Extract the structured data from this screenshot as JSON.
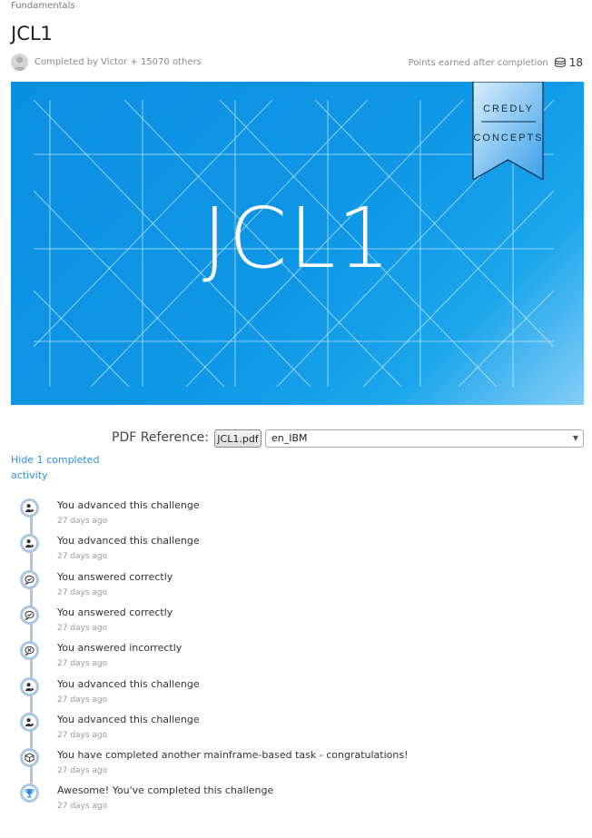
{
  "breadcrumb": "Fundamentals",
  "title": "JCL1",
  "completed_by": "Completed by Victor + 15070 others",
  "points": {
    "label": "Points earned after completion",
    "value": "18",
    "icon": "coins-icon"
  },
  "banner": {
    "title": "JCL1",
    "ribbon_top": "CREDLY",
    "ribbon_bottom": "CONCEPTS"
  },
  "pdf": {
    "label": "PDF Reference:",
    "button": "JCL1.pdf",
    "selected": "en_IBM"
  },
  "hide_link": "Hide 1 completed activity",
  "activities": [
    {
      "text": "You advanced this challenge",
      "time": "27 days ago",
      "icon": "advance-icon"
    },
    {
      "text": "You advanced this challenge",
      "time": "27 days ago",
      "icon": "advance-icon"
    },
    {
      "text": "You answered correctly",
      "time": "27 days ago",
      "icon": "check-icon"
    },
    {
      "text": "You answered correctly",
      "time": "27 days ago",
      "icon": "check-icon"
    },
    {
      "text": "You answered incorrectly",
      "time": "27 days ago",
      "icon": "x-icon"
    },
    {
      "text": "You advanced this challenge",
      "time": "27 days ago",
      "icon": "advance-icon"
    },
    {
      "text": "You advanced this challenge",
      "time": "27 days ago",
      "icon": "advance-icon"
    },
    {
      "text": "You have completed another mainframe-based task - congratulations!",
      "time": "27 days ago",
      "icon": "cube-icon"
    },
    {
      "text": "Awesome! You've completed this challenge",
      "time": "27 days ago",
      "icon": "trophy-icon"
    }
  ]
}
